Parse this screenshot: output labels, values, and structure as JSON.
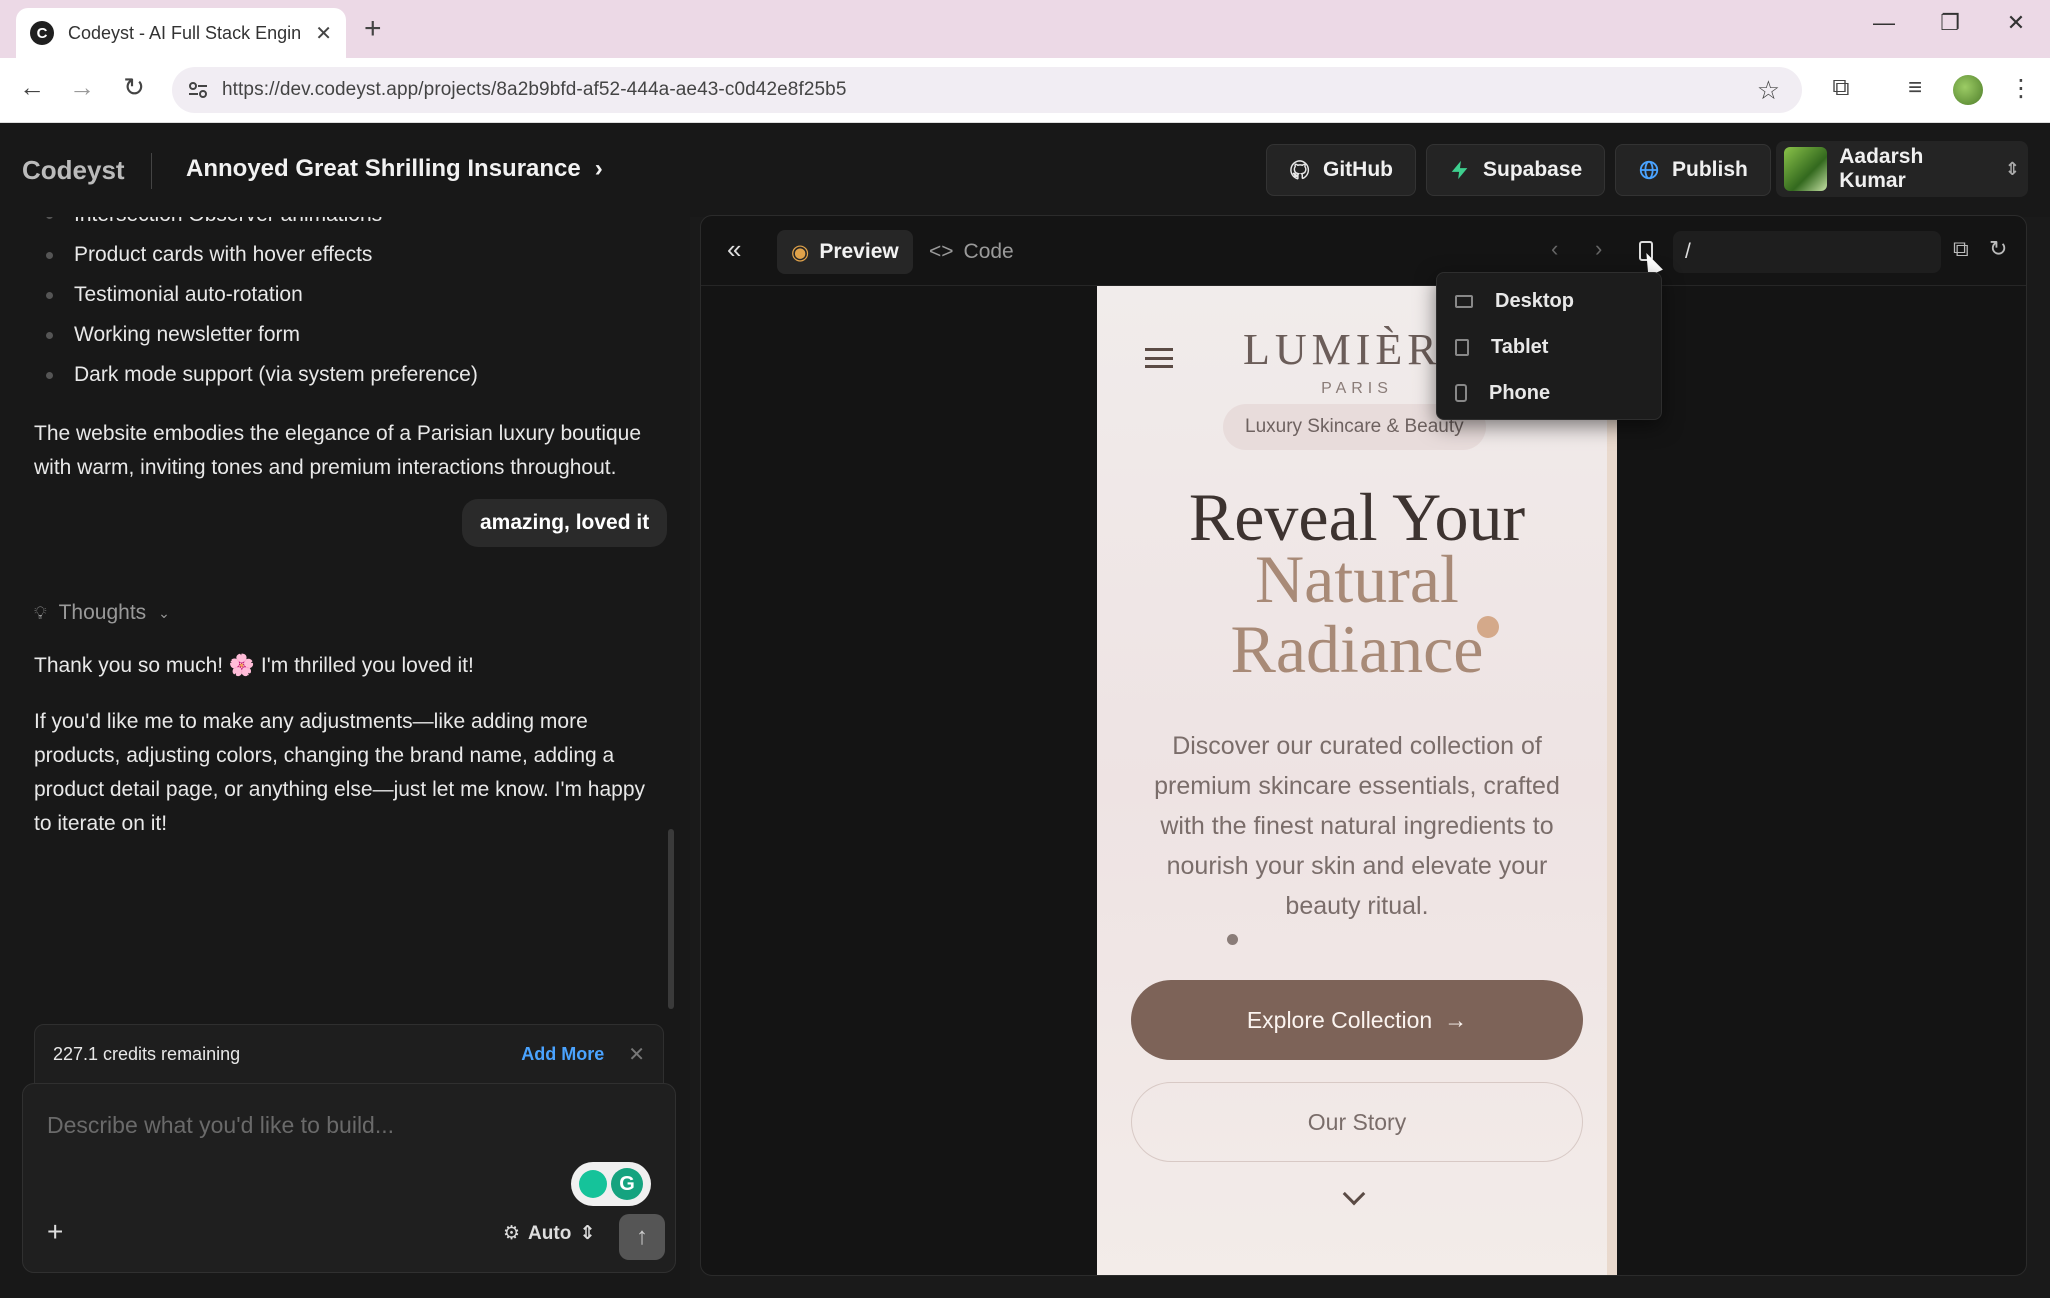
{
  "browser": {
    "tab_title": "Codeyst - AI Full Stack Engineer",
    "url": "https://dev.codeyst.app/projects/8a2b9bfd-af52-444a-ae43-c0d42e8f25b5"
  },
  "header": {
    "logo": "Codeyst",
    "project_name": "Annoyed Great Shrilling Insurance",
    "github_label": "GitHub",
    "supabase_label": "Supabase",
    "publish_label": "Publish",
    "user_name": "Aadarsh Kumar"
  },
  "chat": {
    "bullets": [
      "Intersection Observer animations",
      "Product cards with hover effects",
      "Testimonial auto-rotation",
      "Working newsletter form",
      "Dark mode support (via system preference)"
    ],
    "summary": "The website embodies the elegance of a Parisian luxury boutique with warm, inviting tones and premium interactions throughout.",
    "user_message": "amazing, loved it",
    "thoughts_label": "Thoughts",
    "reply_1": "Thank you so much! 🌸 I'm thrilled you loved it!",
    "reply_2": "If you'd like me to make any adjustments—like adding more products, adjusting colors, changing the brand name, adding a product detail page, or anything else—just let me know. I'm happy to iterate on it!",
    "credits_text": "227.1 credits remaining",
    "add_more": "Add More",
    "input_placeholder": "Describe what you'd like to build...",
    "model_label": "Auto"
  },
  "preview": {
    "preview_tab": "Preview",
    "code_tab": "Code",
    "path": "/",
    "device_menu": [
      "Desktop",
      "Tablet",
      "Phone"
    ]
  },
  "site": {
    "brand": "LUMIÈRE",
    "brand_sub": "PARIS",
    "tagline": "Luxury Skincare & Beauty",
    "headline_1": "Reveal Your",
    "headline_2": "Natural",
    "headline_3": "Radiance",
    "description": "Discover our curated collection of premium skincare essentials, crafted with the finest natural ingredients to nourish your skin and elevate your beauty ritual.",
    "cta_primary": "Explore Collection",
    "cta_secondary": "Our Story"
  }
}
